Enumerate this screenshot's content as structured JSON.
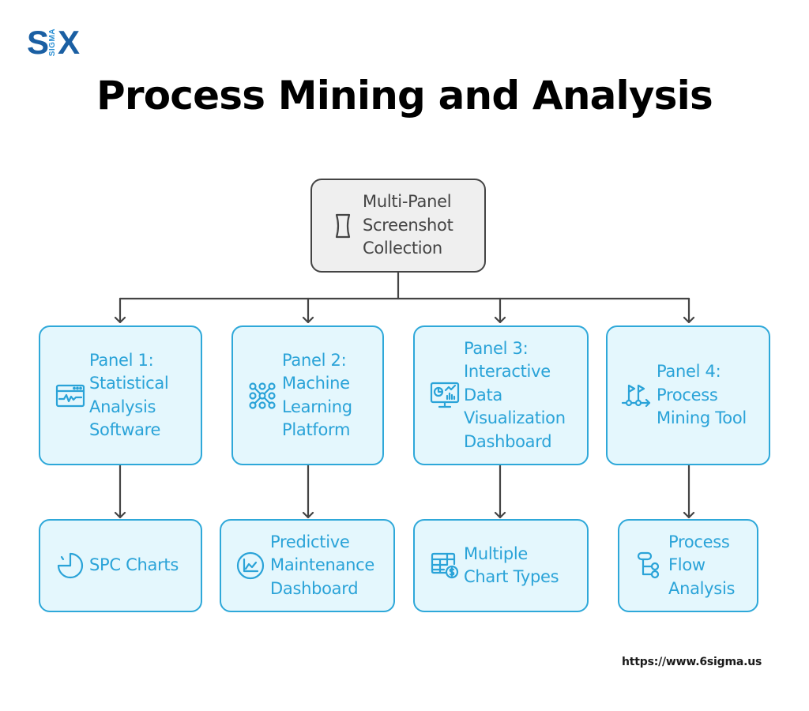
{
  "brand": {
    "logo_left": "S",
    "logo_middle": "SIGMA",
    "logo_right": "X",
    "logo_color": "#1a5fa3"
  },
  "title": "Process Mining and Analysis",
  "root": {
    "icon": "hourglass-frame-icon",
    "lines": [
      "Multi-Panel",
      "Screenshot",
      "Collection"
    ]
  },
  "panels": [
    {
      "icon": "monitor-waveform-icon",
      "lines": [
        "Panel 1:",
        "Statistical",
        "Analysis",
        "Software"
      ]
    },
    {
      "icon": "neural-network-nodes-icon",
      "lines": [
        "Panel 2:",
        "Machine",
        "Learning",
        "Platform"
      ]
    },
    {
      "icon": "dashboard-monitor-icon",
      "lines": [
        "Panel 3:",
        "Interactive",
        "Data",
        "Visualization",
        "Dashboard"
      ]
    },
    {
      "icon": "flags-route-icon",
      "lines": [
        "Panel 4:",
        "Process",
        "Mining Tool"
      ]
    }
  ],
  "outputs": [
    {
      "icon": "pie-chart-icon",
      "lines": [
        "SPC Charts"
      ]
    },
    {
      "icon": "line-chart-circle-icon",
      "lines": [
        "Predictive",
        "Maintenance",
        "Dashboard"
      ]
    },
    {
      "icon": "table-dollar-icon",
      "lines": [
        "Multiple",
        "Chart Types"
      ]
    },
    {
      "icon": "flow-tree-icon",
      "lines": [
        "Process",
        "Flow",
        "Analysis"
      ]
    }
  ],
  "colors": {
    "accent": "#2ea8d9",
    "accent_text": "#2aa3d8",
    "box_fill": "#e4f7fd",
    "root_fill": "#efefef",
    "root_border": "#444444",
    "connector": "#444444"
  },
  "footer": {
    "url": "https://www.6sigma.us"
  }
}
